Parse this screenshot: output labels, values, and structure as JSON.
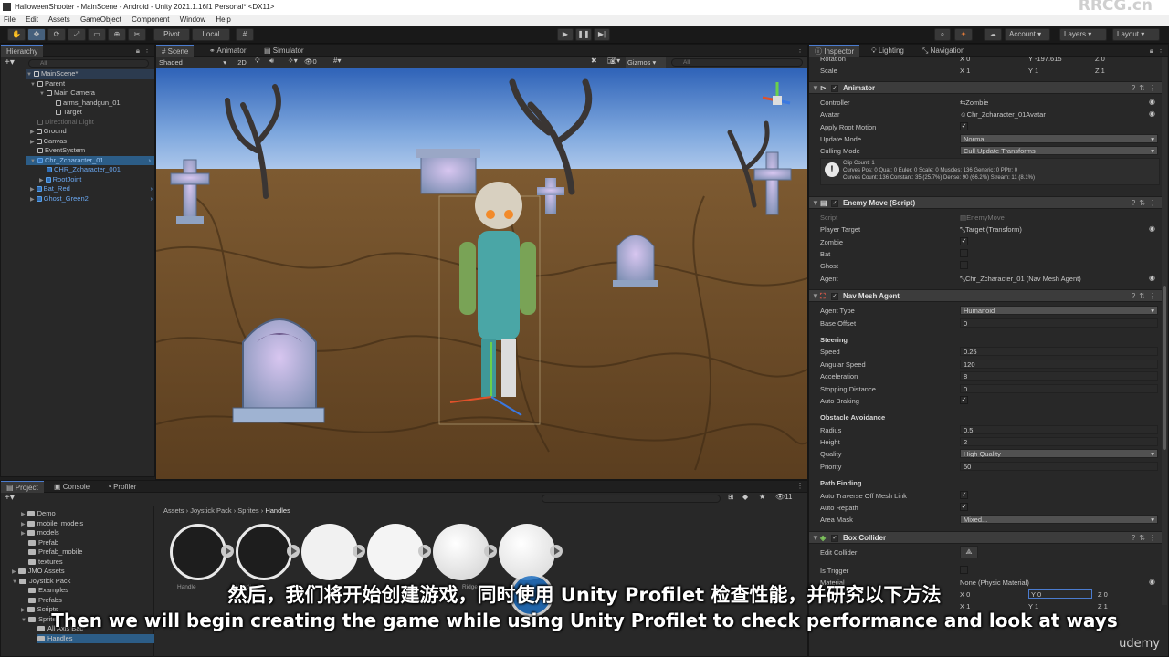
{
  "window": {
    "title": "HalloweenShooter - MainScene - Android - Unity 2021.1.16f1 Personal* <DX11>"
  },
  "menu": [
    "File",
    "Edit",
    "Assets",
    "GameObject",
    "Component",
    "Window",
    "Help"
  ],
  "toolbar": {
    "pivot": "Pivot",
    "local": "Local",
    "account": "Account",
    "layers": "Layers",
    "layout": "Layout"
  },
  "hierarchy": {
    "tab": "Hierarchy",
    "search_placeholder": "All",
    "items": [
      {
        "label": "MainScene*",
        "depth": 0,
        "expanded": true,
        "type": "scene"
      },
      {
        "label": "Parent",
        "depth": 1,
        "expanded": true,
        "type": "object"
      },
      {
        "label": "Main Camera",
        "depth": 2,
        "expanded": true,
        "type": "object"
      },
      {
        "label": "arms_handgun_01",
        "depth": 3,
        "expanded": false,
        "type": "object"
      },
      {
        "label": "Target",
        "depth": 3,
        "expanded": false,
        "type": "object"
      },
      {
        "label": "Directional Light",
        "depth": 1,
        "expanded": false,
        "type": "disabled"
      },
      {
        "label": "Ground",
        "depth": 1,
        "expanded": false,
        "type": "object"
      },
      {
        "label": "Canvas",
        "depth": 1,
        "expanded": false,
        "type": "object"
      },
      {
        "label": "EventSystem",
        "depth": 1,
        "expanded": false,
        "type": "object"
      },
      {
        "label": "Chr_Zcharacter_01",
        "depth": 1,
        "expanded": true,
        "type": "prefab"
      },
      {
        "label": "CHR_Zcharacter_001",
        "depth": 2,
        "expanded": false,
        "type": "prefab"
      },
      {
        "label": "RootJoint",
        "depth": 2,
        "expanded": false,
        "type": "prefab"
      },
      {
        "label": "Bat_Red",
        "depth": 1,
        "expanded": false,
        "type": "prefab"
      },
      {
        "label": "Ghost_Green2",
        "depth": 1,
        "expanded": false,
        "type": "prefab"
      }
    ]
  },
  "scene_view": {
    "tabs": [
      "Scene",
      "Animator",
      "Simulator"
    ],
    "shading": "Shaded",
    "mode_2d": "2D",
    "hidden_count": "0",
    "gizmos": "Gizmos",
    "search_placeholder": "All"
  },
  "project": {
    "tabs": [
      "Project",
      "Console",
      "Profiler"
    ],
    "breadcrumb": [
      "Assets",
      "Joystick Pack",
      "Sprites",
      "Handles"
    ],
    "badge": "11",
    "tree": [
      {
        "label": "Demo",
        "depth": 1
      },
      {
        "label": "mobile_models",
        "depth": 1
      },
      {
        "label": "models",
        "depth": 1
      },
      {
        "label": "Prefab",
        "depth": 1
      },
      {
        "label": "Prefab_mobile",
        "depth": 1
      },
      {
        "label": "textures",
        "depth": 1
      },
      {
        "label": "JMO Assets",
        "depth": 0
      },
      {
        "label": "Joystick Pack",
        "depth": 0
      },
      {
        "label": "Examples",
        "depth": 1
      },
      {
        "label": "Prefabs",
        "depth": 1
      },
      {
        "label": "Scripts",
        "depth": 1
      },
      {
        "label": "Sprites",
        "depth": 1
      },
      {
        "label": "All Axis Bac",
        "depth": 2
      },
      {
        "label": "Handles",
        "depth": 2
      }
    ],
    "assets": [
      "Handle",
      "Handle_D",
      "",
      "",
      "Ridge",
      ""
    ]
  },
  "inspector": {
    "tabs": [
      "Inspector",
      "Lighting",
      "Navigation"
    ],
    "transform": {
      "rotation_label": "Rotation",
      "rotation": {
        "x": "0",
        "y": "-197.615",
        "z": "0"
      },
      "scale_label": "Scale",
      "scale": {
        "x": "1",
        "y": "1",
        "z": "1"
      }
    },
    "animator": {
      "title": "Animator",
      "fields": [
        {
          "label": "Controller",
          "value": "Zombie"
        },
        {
          "label": "Avatar",
          "value": "Chr_Zcharacter_01Avatar"
        },
        {
          "label": "Apply Root Motion",
          "value": "✓"
        },
        {
          "label": "Update Mode",
          "value": "Normal"
        },
        {
          "label": "Culling Mode",
          "value": "Cull Update Transforms"
        }
      ],
      "info": [
        "Clip Count: 1",
        "Curves Pos: 0 Quat: 0 Euler: 0 Scale: 0 Muscles: 136 Generic: 0 PPtr: 0",
        "Curves Count: 136 Constant: 35 (25.7%) Dense: 90 (66.2%) Stream: 11 (8.1%)"
      ]
    },
    "enemy_move": {
      "title": "Enemy Move (Script)",
      "fields": [
        {
          "label": "Script",
          "value": "EnemyMove"
        },
        {
          "label": "Player Target",
          "value": "Target (Transform)"
        },
        {
          "label": "Zombie",
          "value": "✓"
        },
        {
          "label": "Bat",
          "value": ""
        },
        {
          "label": "Ghost",
          "value": ""
        },
        {
          "label": "Agent",
          "value": "Chr_Zcharacter_01 (Nav Mesh Agent)"
        }
      ]
    },
    "nav_mesh_agent": {
      "title": "Nav Mesh Agent",
      "agent_type": {
        "label": "Agent Type",
        "value": "Humanoid"
      },
      "base_offset": {
        "label": "Base Offset",
        "value": "0"
      },
      "steering_title": "Steering",
      "steering": [
        {
          "label": "Speed",
          "value": "0.25"
        },
        {
          "label": "Angular Speed",
          "value": "120"
        },
        {
          "label": "Acceleration",
          "value": "8"
        },
        {
          "label": "Stopping Distance",
          "value": "0"
        },
        {
          "label": "Auto Braking",
          "value": "✓"
        }
      ],
      "avoidance_title": "Obstacle Avoidance",
      "avoidance": [
        {
          "label": "Radius",
          "value": "0.5"
        },
        {
          "label": "Height",
          "value": "2"
        },
        {
          "label": "Quality",
          "value": "High Quality"
        },
        {
          "label": "Priority",
          "value": "50"
        }
      ],
      "pathfinding_title": "Path Finding",
      "pathfinding": [
        {
          "label": "Auto Traverse Off Mesh Link",
          "value": "✓"
        },
        {
          "label": "Auto Repath",
          "value": "✓"
        },
        {
          "label": "Area Mask",
          "value": "Mixed..."
        }
      ]
    },
    "box_collider": {
      "title": "Box Collider",
      "edit_collider": "Edit Collider",
      "is_trigger": "Is Trigger",
      "material": {
        "label": "Material",
        "value": "None (Physic Material)"
      },
      "center": {
        "x": "0",
        "y": "0",
        "z": "0"
      },
      "size": {
        "x": "1",
        "y": "1",
        "z": "1"
      }
    }
  },
  "overlay": {
    "watermark_top": "RRCG.cn",
    "subtitle_cn": "然后，我们将开始创建游戏，同时使用 Unity Profilet 检查性能，并研究以下方法",
    "subtitle_en": "Then we will begin creating the game while using Unity Profilet to check performance and look at ways",
    "udemy": "udemy"
  },
  "colors": {
    "accent": "#4b7ccf",
    "prefab_blue": "#6aa7f0",
    "sky_top": "#2f63b8",
    "sky_bottom": "#a9c7ec",
    "ground": "#6b4a26"
  }
}
